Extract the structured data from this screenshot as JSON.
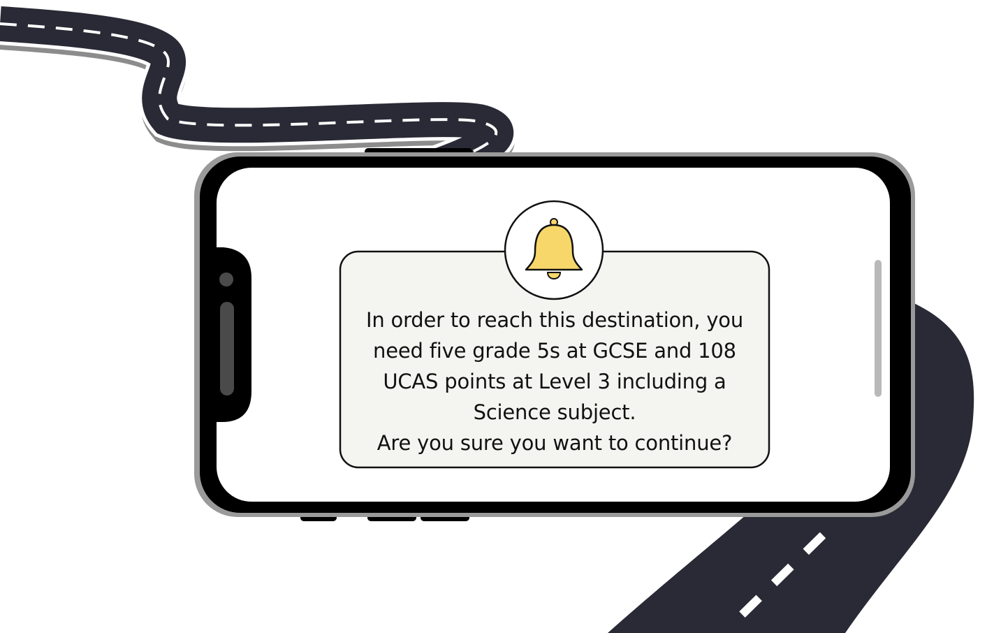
{
  "dialog": {
    "icon": "bell-icon",
    "message_lines": [
      "In order to reach this destination, you",
      "need five grade 5s at GCSE and 108",
      "UCAS points at Level 3 including a",
      "Science subject.",
      "Are you sure you want to continue?"
    ]
  },
  "colors": {
    "road": "#2a2a36",
    "road_shadow": "#8c8c8c",
    "phone_frame": "#000000",
    "phone_rim": "#9a9a9a",
    "screen": "#ffffff",
    "dialog_bg": "#f4f5f0",
    "bell": "#f8d76a"
  }
}
